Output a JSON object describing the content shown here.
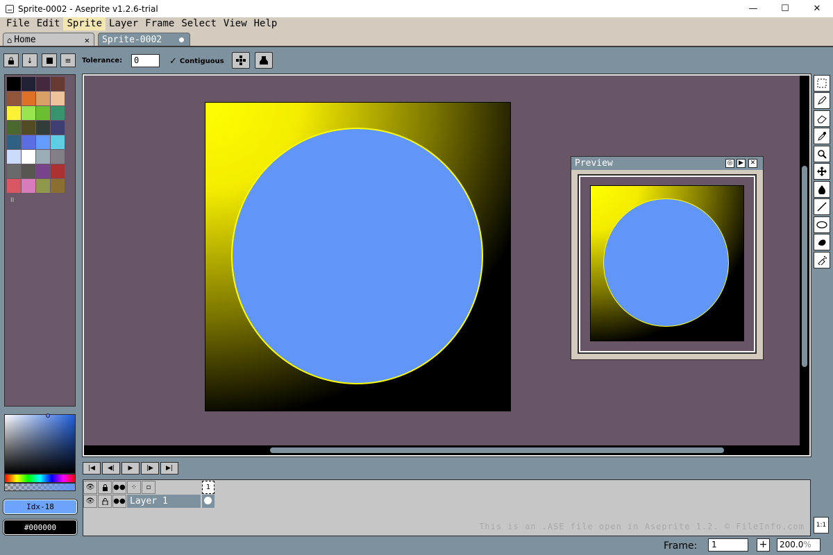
{
  "window": {
    "title": "Sprite-0002 - Aseprite v1.2.6-trial",
    "controls": {
      "minimize": "—",
      "maximize": "☐",
      "close": "✕"
    }
  },
  "menubar": {
    "items": [
      {
        "label": "File"
      },
      {
        "label": "Edit"
      },
      {
        "label": "Sprite",
        "active": true
      },
      {
        "label": "Layer"
      },
      {
        "label": "Frame"
      },
      {
        "label": "Select"
      },
      {
        "label": "View"
      },
      {
        "label": "Help"
      }
    ]
  },
  "tabs": {
    "home": {
      "label": "Home",
      "icon": "home-icon"
    },
    "sprite": {
      "label": "Sprite-0002",
      "modified": true
    }
  },
  "tool_options": {
    "tolerance_label": "Tolerance:",
    "tolerance_value": "0",
    "contiguous_label": "Contiguous",
    "contiguous_checked": true
  },
  "palette": {
    "colors": [
      "#000000",
      "#222034",
      "#45283c",
      "#663931",
      "#8f563b",
      "#df7126",
      "#d9a066",
      "#eec39a",
      "#fbf236",
      "#99e550",
      "#6abe30",
      "#37946e",
      "#4b692f",
      "#524b24",
      "#323c39",
      "#3f3f74",
      "#306082",
      "#5b6ee1",
      "#639bff",
      "#5fcde4",
      "#cbdbfc",
      "#ffffff",
      "#9badb7",
      "#847e87",
      "#696a6a",
      "#595652",
      "#76428a",
      "#ac3232",
      "#d95763",
      "#d77bba",
      "#8f974a",
      "#8a6f30"
    ],
    "mark": "II"
  },
  "color_bar": {
    "foreground_label": "Idx-18",
    "foreground_color": "#6ca3fb",
    "background_label": "#000000",
    "background_color": "#000000"
  },
  "preview": {
    "title": "Preview"
  },
  "toolbar": {
    "tools": [
      "rectangular-marquee-icon",
      "pencil-icon",
      "eraser-icon",
      "eyedropper-icon",
      "zoom-icon",
      "move-icon",
      "paint-bucket-icon",
      "line-icon",
      "ellipse-icon",
      "blur-icon",
      "spray-icon"
    ]
  },
  "timeline": {
    "frame_number": "1",
    "layer_name": "Layer 1",
    "watermark": "This is an .ASE file open in Aseprite 1.2. © FileInfo.com",
    "zoom_button": "1:1"
  },
  "status": {
    "frame_label": "Frame:",
    "frame_value": "1",
    "add_frame": "+",
    "zoom": "200.0"
  },
  "colors": {
    "workspace": "#685666",
    "ui_blue": "#7d929e",
    "circle": "#6196f8",
    "gradient_yellow": "#ffff00"
  }
}
